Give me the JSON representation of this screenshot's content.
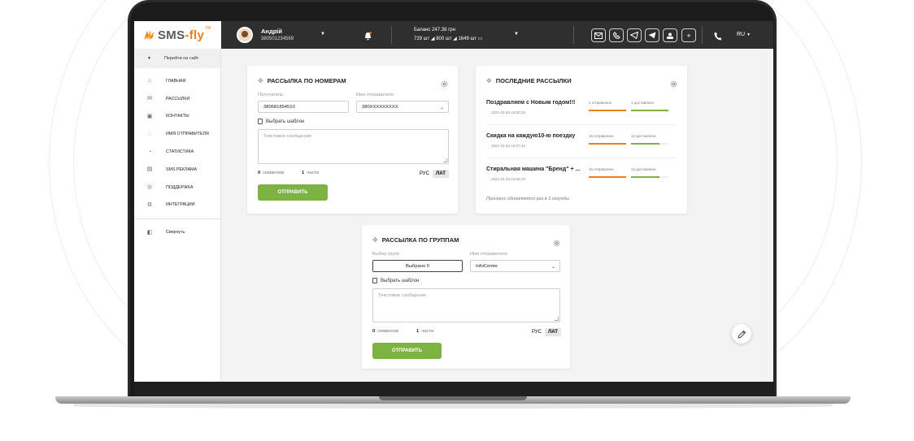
{
  "logo": {
    "brand": "SMS",
    "dash": "-",
    "fly": "fly",
    "tm": "TM"
  },
  "topbar": {
    "user_name": "Андрій",
    "user_phone": "380501234569",
    "balance_line1": "Баланс 247.38 грн",
    "balance_line2_a": "729 шт",
    "balance_line2_b": "800 шт",
    "balance_line2_c": "1649 шт",
    "language": "RU",
    "icons": [
      "mail-icon",
      "viber-icon",
      "telegram-icon",
      "send-icon",
      "contacts-icon",
      "plus-icon",
      "phone-icon"
    ]
  },
  "sidebar": {
    "goto_site": "Перейти на сайт",
    "items": [
      {
        "label": "Главная",
        "icon": "home-icon"
      },
      {
        "label": "Рассылки",
        "icon": "mail-icon"
      },
      {
        "label": "Контакты",
        "icon": "contacts-icon"
      },
      {
        "label": "Имя отправителя",
        "icon": "chat-icon"
      },
      {
        "label": "Статистика",
        "icon": "pie-icon"
      },
      {
        "label": "SMS реклама",
        "icon": "ad-icon"
      },
      {
        "label": "Поддержка",
        "icon": "support-icon"
      },
      {
        "label": "Интеграции",
        "icon": "gear-icon"
      }
    ],
    "collapse": "Свернуть"
  },
  "by_number": {
    "title": "РАССЫЛКА ПО НОМЕРАМ",
    "recipient_label": "Получатель",
    "recipient_value": "380681854510",
    "sender_label": "Имя отправителя",
    "sender_value": "380XXXXXXXXX",
    "template_link": "Выбрать шаблон",
    "message_placeholder": "Текстовое сообщение",
    "chars_count": "0",
    "chars_label": "символов",
    "parts_count": "1",
    "parts_label": "части",
    "lang_ru": "РУС",
    "lang_lat": "ЛАТ",
    "send_button": "ОТПРАВИТЬ"
  },
  "recent": {
    "title": "ПОСЛЕДНИЕ РАССЫЛКИ",
    "items": [
      {
        "title": "Поздравляем с Новым годом!!!",
        "date": "2021-01-04 10:00:29",
        "sent": "1 отправлено",
        "delivered": "1 доставлено",
        "sent_fraction": 1.0,
        "delivered_fraction": 1.0
      },
      {
        "title": "Скидка на каждую10-ю поездку",
        "date": "2021-01-04 10:07:44",
        "sent": "16 отправлено",
        "delivered": "12 доставлено",
        "sent_fraction": 1.0,
        "delivered_fraction": 0.75
      },
      {
        "title": "Стиральная машина \"Бренд\" + ...",
        "date": "2021-01-04 10:06:18",
        "sent": "16 отправлено",
        "delivered": "12 доставлено",
        "sent_fraction": 1.0,
        "delivered_fraction": 0.75
      }
    ],
    "progress_note": "Прогресс обновляется раз в 3 секунды"
  },
  "by_group": {
    "title": "РАССЫЛКА ПО ГРУППАМ",
    "groups_label": "Выбор групп",
    "groups_value": "Выбрано 0",
    "sender_label": "Имя отправителя",
    "sender_value": "InfoCenter",
    "template_link": "Выбрать шаблон",
    "message_placeholder": "Текстовое сообщение",
    "chars_count": "0",
    "chars_label": "символов",
    "parts_count": "1",
    "parts_label": "части",
    "lang_ru": "РУС",
    "lang_lat": "ЛАТ",
    "send_button": "ОТПРАВИТЬ"
  },
  "colors": {
    "accent_green": "#7cb342",
    "accent_orange": "#ef7f1a",
    "topbar": "#2f2f2f"
  }
}
